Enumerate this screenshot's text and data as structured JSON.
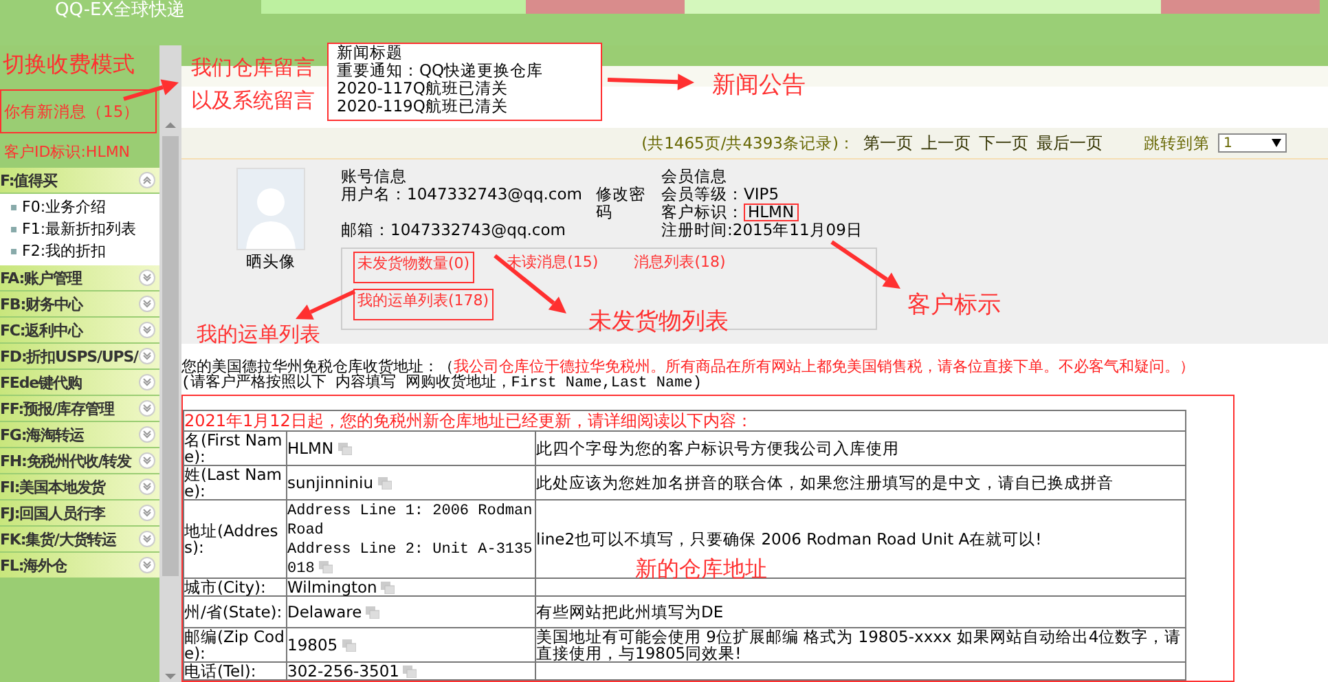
{
  "header": {
    "title": "QQ-EX全球快递"
  },
  "sidebar": {
    "notice": "切换收费模式",
    "message": "你有新消息（15）",
    "customer_id": "客户ID标识:HLMN",
    "menu": [
      {
        "label": "F:值得买",
        "expanded": true,
        "children": [
          {
            "label": "F0:业务介绍"
          },
          {
            "label": "F1:最新折扣列表"
          },
          {
            "label": "F2:我的折扣"
          }
        ]
      },
      {
        "label": "FA:账户管理",
        "expanded": false
      },
      {
        "label": "FB:财务中心",
        "expanded": false
      },
      {
        "label": "FC:返利中心",
        "expanded": false
      },
      {
        "label": "FD:折扣USPS/UPS/",
        "expanded": false
      },
      {
        "label": "FEde键代购",
        "expanded": false
      },
      {
        "label": "FF:预报/库存管理",
        "expanded": false
      },
      {
        "label": "FG:海淘转运",
        "expanded": false
      },
      {
        "label": "FH:免税州代收/转发",
        "expanded": false
      },
      {
        "label": "FI:美国本地发货",
        "expanded": false
      },
      {
        "label": "FJ:回国人员行李",
        "expanded": false
      },
      {
        "label": "FK:集货/大货转运",
        "expanded": false
      },
      {
        "label": "FL:海外仓",
        "expanded": false
      }
    ]
  },
  "news": {
    "title": "新闻标题",
    "items": [
      "重要通知：QQ快递更换仓库",
      "2020-117Q航班已清关",
      "2020-119Q航班已清关"
    ]
  },
  "pagination": {
    "summary": "(共1465页/共4393条记录)：",
    "links": [
      "第一页",
      "上一页",
      "下一页",
      "最后一页"
    ],
    "jump_label": "跳转到第",
    "page": "1"
  },
  "profile": {
    "avatar_label": "晒头像",
    "account": {
      "heading": "账号信息",
      "username": "用户名：1047332743@qq.com",
      "change_password": "修改密码",
      "email": "邮箱：1047332743@qq.com"
    },
    "member": {
      "heading": "会员信息",
      "level": "会员等级：VIP5",
      "customer_id_label": "客户标识：",
      "customer_id": "HLMN",
      "registered": "注册时间:2015年11月09日"
    },
    "links": [
      "未发货物数量(0)",
      "未读消息(15)",
      "消息列表(18)",
      "我的运单列表(178)"
    ]
  },
  "address": {
    "intro": "您的美国德拉华州免税仓库收货地址：（",
    "note": "我公司仓库位于德拉华免税州。所有商品在所有网站上都免美国销售税，请各位直接下单。不必客气和疑问。）",
    "instruction": "(请客户严格按照以下 内容填写 网购收货地址，First Name,Last Name)",
    "table_title": "2021年1月12日起，您的免税州新仓库地址已经更新，请详细阅读以下内容：",
    "rows": [
      {
        "label": "名(First Name):",
        "lines": [
          "HLMN"
        ],
        "note": "此四个字母为您的客户标识号方便我公司入库使用"
      },
      {
        "label": "姓(Last Name):",
        "lines": [
          "sunjinniniu"
        ],
        "note": "此处应该为您姓加名拼音的联合体，如果您注册填写的是中文，请自已换成拼音"
      },
      {
        "label": "地址(Address):",
        "kind": "mono",
        "lines": [
          "Address Line 1: 2006 Rodman Road",
          "Address Line 2: Unit A-3135018"
        ],
        "note": "line2也可以不填写，只要确保 2006 Rodman Road Unit A在就可以!"
      },
      {
        "label": "城市(City):",
        "lines": [
          "Wilmington"
        ]
      },
      {
        "label": "州/省(State):",
        "lines": [
          "Delaware"
        ],
        "note": "有些网站把此州填写为DE"
      },
      {
        "label": "邮编(Zip Code):",
        "lines": [
          "19805"
        ],
        "note": "美国地址有可能会使用 9位扩展邮编 格式为 19805-xxxx 如果网站自动给出4位数字，请直接使用，与19805同效果!"
      },
      {
        "label": "电话(Tel):",
        "lines": [
          "302-256-3501"
        ]
      }
    ]
  },
  "annotations": [
    "我们仓库留言",
    "以及系统留言",
    "新闻公告",
    "客户标示",
    "未发货物列表",
    "我的运单列表",
    "新的仓库地址"
  ]
}
